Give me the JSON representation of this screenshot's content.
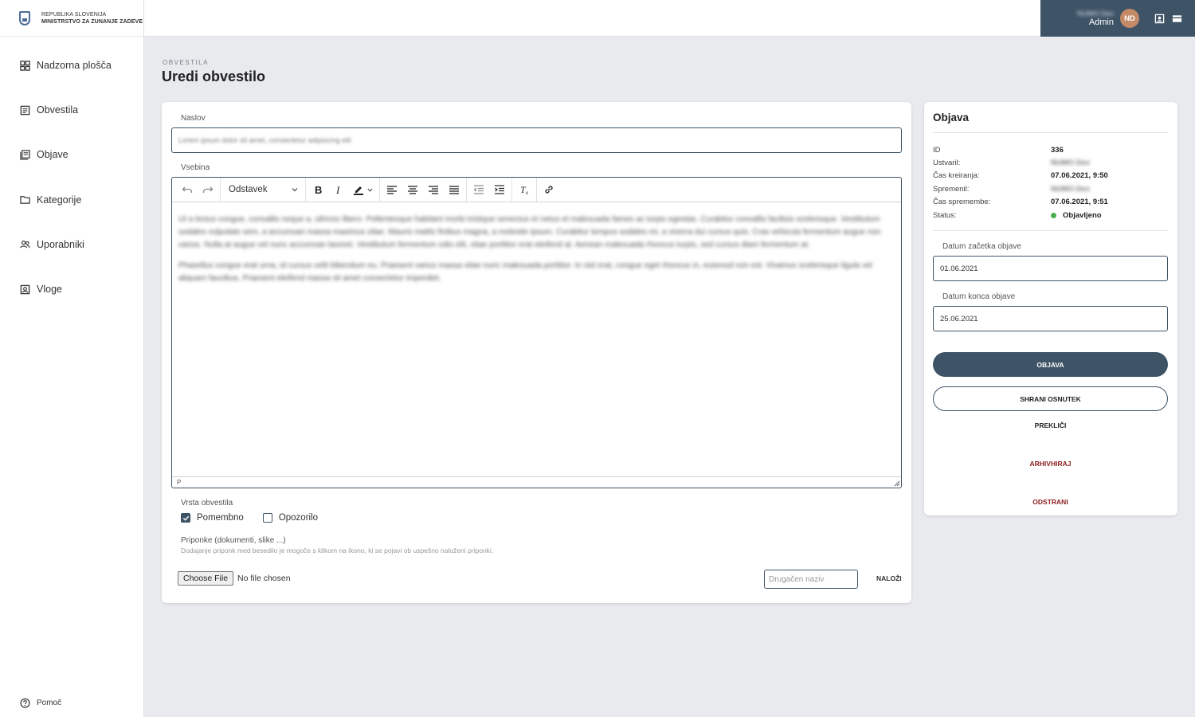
{
  "brand": {
    "line1": "REPUBLIKA SLOVENIJA",
    "line2": "MINISTRSTVO ZA ZUNANJE ZADEVE"
  },
  "sidebar": {
    "items": [
      {
        "label": "Nadzorna plošča",
        "icon": "dashboard-icon"
      },
      {
        "label": "Obvestila",
        "icon": "notice-icon"
      },
      {
        "label": "Objave",
        "icon": "posts-icon"
      },
      {
        "label": "Kategorije",
        "icon": "folder-icon"
      },
      {
        "label": "Uporabniki",
        "icon": "users-icon"
      },
      {
        "label": "Vloge",
        "icon": "role-icon"
      }
    ],
    "help_label": "Pomoč"
  },
  "user": {
    "name": "NUMO Dev",
    "role": "Admin",
    "initials": "ND"
  },
  "page": {
    "breadcrumb": "OBVESTILA",
    "title": "Uredi obvestilo"
  },
  "form": {
    "title_label": "Naslov",
    "title_value": "Lorem ipsum dolor sit amet, consectetur adipiscing elit",
    "content_label": "Vsebina",
    "block_format": "Odstavek",
    "content_paragraphs": [
      "Ut a lectus congue, convallis neque a, ultrices libero. Pellentesque habitant morbi tristique senectus et netus et malesuada fames ac turpis egestas. Curabitur convallis facilisis scelerisque. Vestibulum sodales vulputate sem, a accumsan massa maximus vitae. Mauris mattis finibus magna, a molestie ipsum. Curabitur tempus sodales mi, a viverra dui cursus quis. Cras vehicula fermentum augue non varius. Nulla at augue vel nunc accumsan laoreet. Vestibulum fermentum odio elit, vitae porttitor erat eleifend at. Aenean malesuada rhoncus turpis, sed cursus diam fermentum at.",
      "Phasellus congue erat urna, id cursus velit bibendum eu. Praesent varius massa vitae nunc malesuada porttitor. In nisl erat, congue eget rhoncus in, euismod non est. Vivamus scelerisque ligula vel aliquam faucibus. Praesent eleifend massa sit amet consectetur imperdiet."
    ],
    "editor_path": "P",
    "type_label": "Vrsta obvestila",
    "type_options": [
      {
        "label": "Pomembno",
        "checked": true
      },
      {
        "label": "Opozorilo",
        "checked": false
      }
    ],
    "attachments_label": "Priponke (dokumenti, slike ...)",
    "attachments_hint": "Dodajanje priponk med besedilo je mogoče s klikom na ikono, ki se pojavi ob uspešno naloženi priponki.",
    "file_button": "Choose File",
    "file_status": "No file chosen",
    "alt_name_placeholder": "Drugačen naziv",
    "upload_label": "NALOŽI"
  },
  "publish": {
    "title": "Objava",
    "meta": [
      {
        "key": "ID",
        "value": "336",
        "blurred": false
      },
      {
        "key": "Ustvaril:",
        "value": "NUMO Dev",
        "blurred": true
      },
      {
        "key": "Čas kreiranja:",
        "value": "07.06.2021, 9:50",
        "blurred": false
      },
      {
        "key": "Spremenil:",
        "value": "NUMO Dev",
        "blurred": true
      },
      {
        "key": "Čas spremembe:",
        "value": "07.06.2021, 9:51",
        "blurred": false
      },
      {
        "key": "Status:",
        "value": "Objavljeno",
        "blurred": false
      }
    ],
    "start_label": "Datum začetka objave",
    "start_value": "01.06.2021",
    "end_label": "Datum konca objave",
    "end_value": "25.06.2021",
    "publish_button": "OBJAVA",
    "draft_button": "SHRANI OSNUTEK",
    "cancel_button": "PREKLIČI",
    "archive_button": "ARHIVHIRAJ",
    "delete_button": "ODSTRANI"
  },
  "colors": {
    "primary": "#3e5366",
    "danger": "#8b1c1c",
    "status_ok": "#4caf50",
    "avatar": "#c48a68",
    "background": "#e8eaed"
  }
}
